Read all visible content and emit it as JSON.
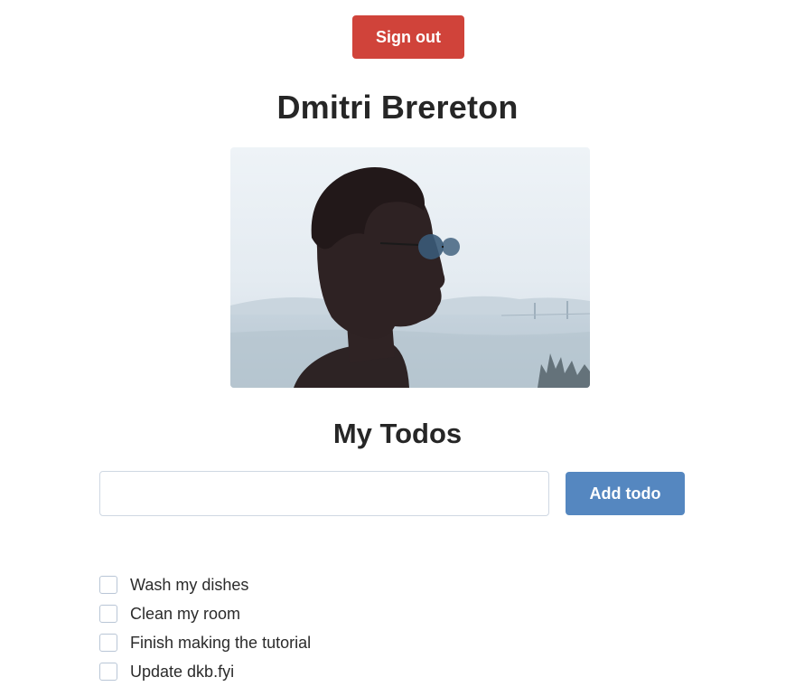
{
  "header": {
    "signout_label": "Sign out"
  },
  "profile": {
    "name": "Dmitri Brereton"
  },
  "todos": {
    "heading": "My Todos",
    "input_value": "",
    "input_placeholder": "",
    "add_label": "Add todo",
    "items": [
      {
        "label": "Wash my dishes",
        "checked": false
      },
      {
        "label": "Clean my room",
        "checked": false
      },
      {
        "label": "Finish making the tutorial",
        "checked": false
      },
      {
        "label": "Update dkb.fyi",
        "checked": false
      }
    ]
  },
  "colors": {
    "signout": "#d0433a",
    "add": "#5587c0"
  }
}
